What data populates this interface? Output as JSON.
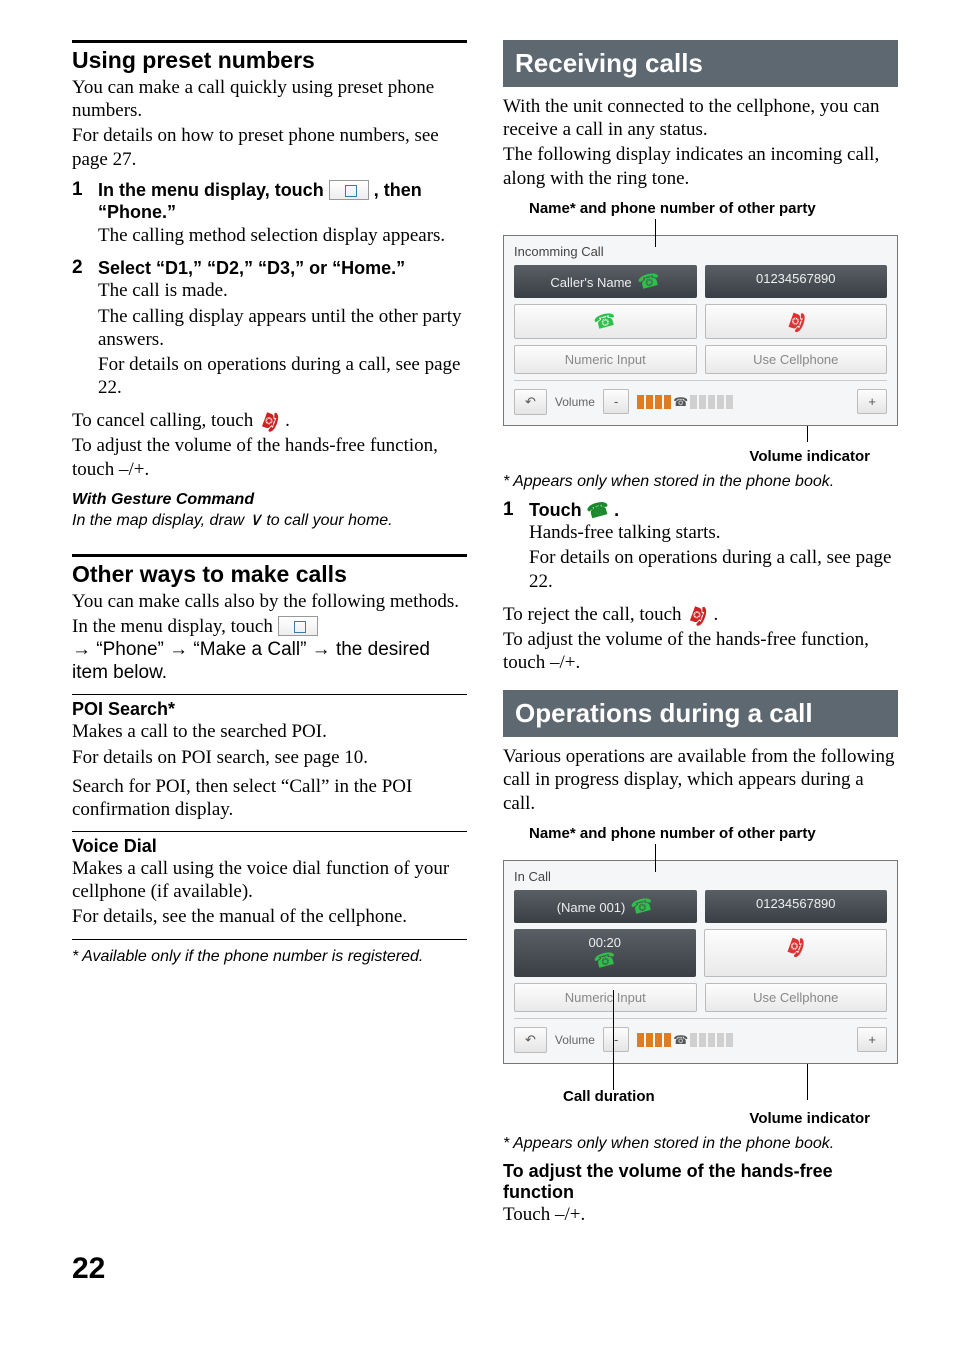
{
  "left": {
    "h_preset": "Using preset numbers",
    "preset_p1": "You can make a call quickly using preset phone numbers.",
    "preset_p2": "For details on how to preset phone numbers, see page 27.",
    "step1_num": "1",
    "step1_lead_a": "In the menu display, touch ",
    "step1_lead_b": ", then “Phone.”",
    "step1_body": "The calling method selection display appears.",
    "step2_num": "2",
    "step2_lead": "Select “D1,” “D2,” “D3,” or “Home.”",
    "step2_body1": "The call is made.",
    "step2_body2": "The calling display appears until the other party answers.",
    "step2_body3": "For details on operations during a call, see page 22.",
    "cancel": "To cancel calling, touch ",
    "cancel_b": ".",
    "adjvol": "To adjust the volume of the hands-free function, touch –/+.",
    "gesture_h": "With Gesture Command",
    "gesture_p_a": "In the map display, draw ",
    "gesture_p_b": " to call your home.",
    "h_other": "Other ways to make calls",
    "other_p1": "You can make calls also by the following methods.",
    "other_p2_a": "In the menu display, touch ",
    "other_p2_b": " → “Phone” → “Make a Call” → the desired item below.",
    "poi_h": "POI Search*",
    "poi_p1": "Makes a call to the searched POI.",
    "poi_p2": "For details on POI search, see page 10.",
    "poi_p3": "Search for POI, then select “Call” in the POI confirmation display.",
    "voice_h": "Voice Dial",
    "voice_p1": "Makes a call using the voice dial function of your cellphone (if available).",
    "voice_p2": "For details, see the manual of the cellphone.",
    "foot": "* Available only if the phone number is registered."
  },
  "right": {
    "h_recv": "Receiving calls",
    "recv_p1": "With the unit connected to the cellphone, you can receive a call in any status.",
    "recv_p2": "The following display indicates an incoming call, along with the ring tone.",
    "namephone": "Name* and phone number of other party",
    "shot1": {
      "header": "Incomming Call",
      "name": "Caller's Name",
      "number": "01234567890",
      "numin": "Numeric Input",
      "usecell": "Use Cellphone",
      "back": "↶",
      "vol": "Volume",
      "minus": "-",
      "plus": "+"
    },
    "volind": "Volume indicator",
    "appears": "* Appears only when stored in the phone book.",
    "step1_num": "1",
    "step1_lead_a": "Touch ",
    "step1_lead_b": ".",
    "step1_body1": "Hands-free talking starts.",
    "step1_body2": "For details on operations during a call, see page 22.",
    "reject_a": "To reject the call, touch ",
    "reject_b": ".",
    "adjvol": "To adjust the volume of the hands-free function, touch –/+.",
    "h_ops": "Operations during a call",
    "ops_p1": "Various operations are available from the following call in progress display, which appears during a call.",
    "namephone2": "Name* and phone number of other party",
    "shot2": {
      "header": "In Call",
      "name": "(Name 001)",
      "number": "01234567890",
      "dur": "00:20",
      "numin": "Numeric Input",
      "usecell": "Use Cellphone",
      "back": "↶",
      "vol": "Volume",
      "minus": "-",
      "plus": "+"
    },
    "calldur": "Call duration",
    "volind2": "Volume indicator",
    "appears2": "* Appears only when stored in the phone book.",
    "adj_h": "To adjust the volume of the hands-free function",
    "adj_p": "Touch –/+."
  },
  "page": "22"
}
